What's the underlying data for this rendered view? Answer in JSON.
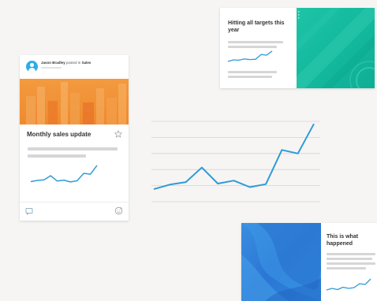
{
  "post_card": {
    "author": "Jason Bradley",
    "posted_in": "posted in",
    "channel": "Sales",
    "title": "Monthly sales update",
    "icons": [
      "person-icon",
      "star-icon",
      "comment-icon",
      "reaction-icon"
    ]
  },
  "targets_card": {
    "title": "Hitting all targets this year"
  },
  "happened_card": {
    "title": "This is what happened"
  },
  "colors": {
    "background": "#f6f5f4",
    "line": "#2f9bd6",
    "orange_banner": "#ef8a2e",
    "teal_banner": "#12b89d",
    "blue_banner": "#2a76d4",
    "avatar": "#2eaee6",
    "placeholder": "#d6d6d6"
  },
  "chart_data": [
    {
      "type": "line",
      "series": [
        {
          "values": [
            2.5,
            3.4,
            3.9,
            6.8,
            3.6,
            4.2,
            2.9,
            3.5,
            10.3,
            9.6,
            15.5
          ]
        }
      ],
      "grid": true
    },
    {
      "type": "line",
      "series": [
        {
          "values": [
            2.0,
            2.4,
            2.6,
            4.0,
            2.2,
            2.5,
            1.9,
            2.3,
            4.8,
            4.5,
            7.5
          ]
        }
      ],
      "grid": false
    },
    {
      "type": "line",
      "series": [
        {
          "values": [
            2.0,
            3.0,
            2.8,
            3.6,
            3.2,
            3.4,
            6.4,
            6.0,
            8.6
          ]
        }
      ],
      "grid": false
    },
    {
      "type": "line",
      "series": [
        {
          "values": [
            2.0,
            2.8,
            2.2,
            3.4,
            2.8,
            3.2,
            5.2,
            4.8,
            7.6
          ]
        }
      ],
      "grid": false
    }
  ]
}
